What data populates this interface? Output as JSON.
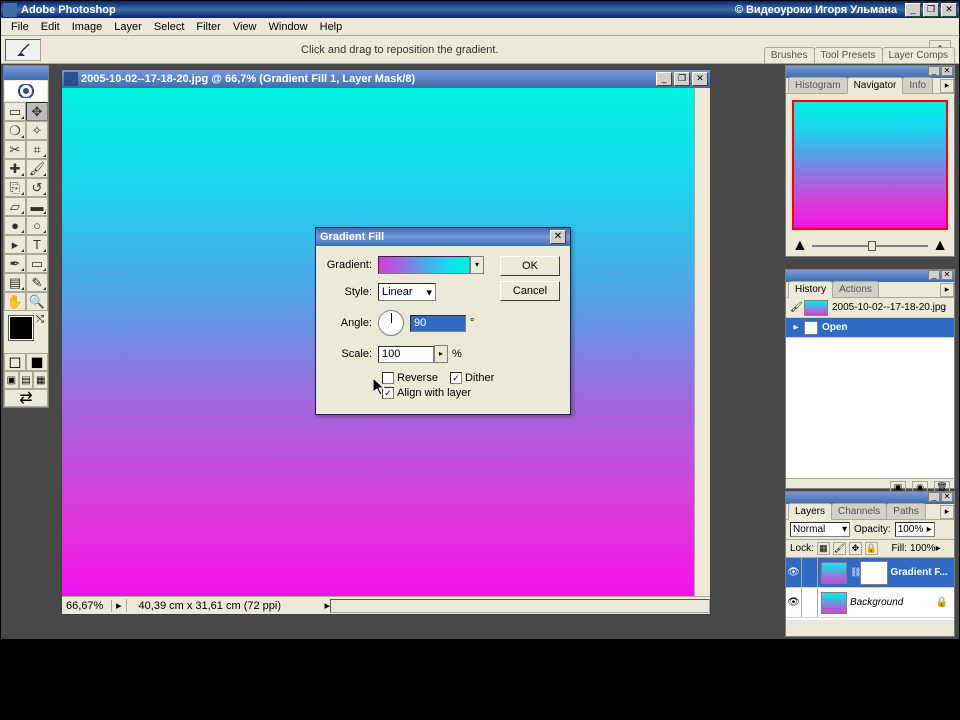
{
  "app": {
    "title": "Adobe Photoshop",
    "credits": "© Видеоуроки Игоря Ульмана"
  },
  "menu": [
    "File",
    "Edit",
    "Image",
    "Layer",
    "Select",
    "Filter",
    "View",
    "Window",
    "Help"
  ],
  "optionsbar": {
    "hint": "Click and drag to reposition the gradient.",
    "tabs": [
      "Brushes",
      "Tool Presets",
      "Layer Comps"
    ]
  },
  "document": {
    "title": "2005-10-02--17-18-20.jpg @ 66,7% (Gradient Fill 1, Layer Mask/8)",
    "zoom": "66,67%",
    "info": "40,39 cm x 31,61 cm (72 ppi)"
  },
  "dialog": {
    "title": "Gradient Fill",
    "labels": {
      "gradient": "Gradient:",
      "style": "Style:",
      "angle": "Angle:",
      "scale": "Scale:",
      "reverse": "Reverse",
      "dither": "Dither",
      "align": "Align with layer"
    },
    "style_value": "Linear",
    "angle_value": "90",
    "angle_unit": "°",
    "scale_value": "100",
    "scale_unit": "%",
    "buttons": {
      "ok": "OK",
      "cancel": "Cancel"
    },
    "reverse_checked": false,
    "dither_checked": true,
    "align_checked": true
  },
  "panels": {
    "navigator": {
      "tabs": [
        "Histogram",
        "Navigator",
        "Info"
      ],
      "active": 1
    },
    "history": {
      "tabs": [
        "History",
        "Actions"
      ],
      "snapshot": "2005-10-02--17-18-20.jpg",
      "items": [
        {
          "label": "Open",
          "selected": true
        }
      ]
    },
    "layers": {
      "tabs": [
        "Layers",
        "Channels",
        "Paths"
      ],
      "blend": "Normal",
      "opacity_label": "Opacity:",
      "opacity": "100%",
      "lock_label": "Lock:",
      "fill_label": "Fill:",
      "fill": "100%",
      "items": [
        {
          "name": "Gradient F...",
          "selected": true,
          "has_mask": true
        },
        {
          "name": "Background",
          "selected": false,
          "locked": true
        }
      ]
    }
  }
}
